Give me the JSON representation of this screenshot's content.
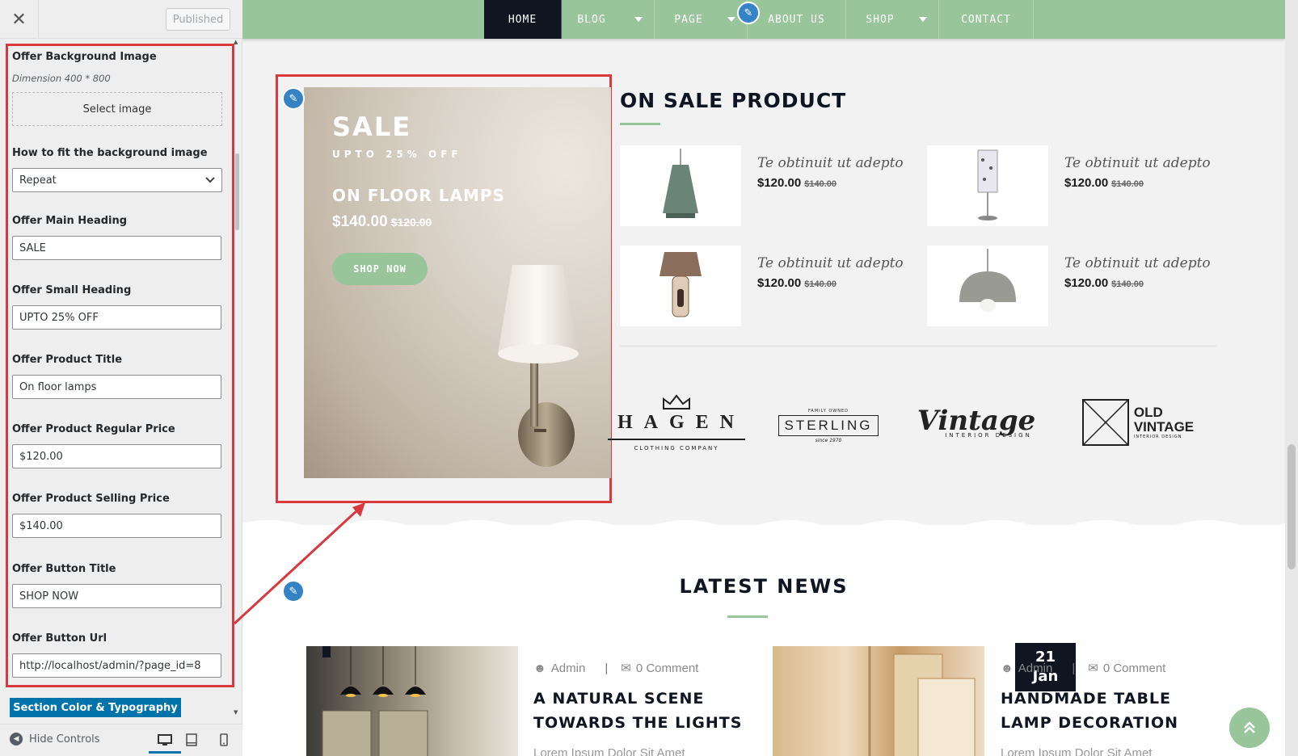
{
  "customizer": {
    "close_icon": "close-icon",
    "published_label": "Published",
    "fields": {
      "bg_image_label": "Offer Background Image",
      "bg_image_desc": "Dimension 400 * 800",
      "select_image_label": "Select image",
      "fit_label": "How to fit the background image",
      "fit_value": "Repeat",
      "main_heading_label": "Offer Main Heading",
      "main_heading_value": "SALE",
      "small_heading_label": "Offer Small Heading",
      "small_heading_value": "UPTO 25% OFF",
      "product_title_label": "Offer Product Title",
      "product_title_value": "On floor lamps",
      "regular_price_label": "Offer Product Regular Price",
      "regular_price_value": "$120.00",
      "selling_price_label": "Offer Product Selling Price",
      "selling_price_value": "$140.00",
      "button_title_label": "Offer Button Title",
      "button_title_value": "SHOP NOW",
      "button_url_label": "Offer Button Url",
      "button_url_value": "http://localhost/admin/?page_id=8"
    },
    "section_color_label": "Section Color & Typography",
    "hide_controls_label": "Hide Controls",
    "accent_color": "#0073aa",
    "highlight_color": "#d9383f"
  },
  "nav": {
    "items": [
      "HOME",
      "BLOG",
      "PAGE",
      "ABOUT US",
      "SHOP",
      "CONTACT"
    ],
    "bar_color": "#98c59a",
    "active_color": "#0f1621"
  },
  "offer": {
    "heading": "SALE",
    "small_heading": "UPTO 25% OFF",
    "product_title": "On floor lamps",
    "price": "$140.00",
    "old_price": "$120.00",
    "button": "SHOP NOW"
  },
  "sale_products": {
    "title": "ON SALE PRODUCT",
    "items": [
      {
        "name": "Te obtinuit ut adepto",
        "price": "$120.00",
        "old_price": "$140.00",
        "icon": "pendant-lamp"
      },
      {
        "name": "Te obtinuit ut adepto",
        "price": "$120.00",
        "old_price": "$140.00",
        "icon": "table-lamp"
      },
      {
        "name": "Te obtinuit ut adepto",
        "price": "$120.00",
        "old_price": "$140.00",
        "icon": "desk-lamp"
      },
      {
        "name": "Te obtinuit ut adepto",
        "price": "$120.00",
        "old_price": "$140.00",
        "icon": "dome-lamp"
      }
    ]
  },
  "brands": {
    "hagen": "HAGEN",
    "hagen_sub": "CLOTHING COMPANY",
    "sterling_top": "FAMILY OWNED",
    "sterling": "STERLING",
    "sterling_bottom": "since 1970",
    "vintage": "Vintage",
    "vintage_sub": "INTERIOR DESIGN",
    "old_vintage_1": "OLD",
    "old_vintage_2": "VINTAGE",
    "old_vintage_sub": "INTERIOR DESIGN"
  },
  "news": {
    "title": "LATEST NEWS",
    "posts": [
      {
        "author": "Admin",
        "comments": "0 Comment",
        "title": "A NATURAL SCENE TOWARDS THE LIGHTS",
        "excerpt": "Lorem Ipsum Dolor Sit Amet"
      },
      {
        "author": "Admin",
        "comments": "0 Comment",
        "title": "HANDMADE TABLE LAMP DECORATION",
        "excerpt": "Lorem Ipsum Dolor Sit Amet",
        "date_day": "21",
        "date_month": "Jan"
      }
    ]
  }
}
